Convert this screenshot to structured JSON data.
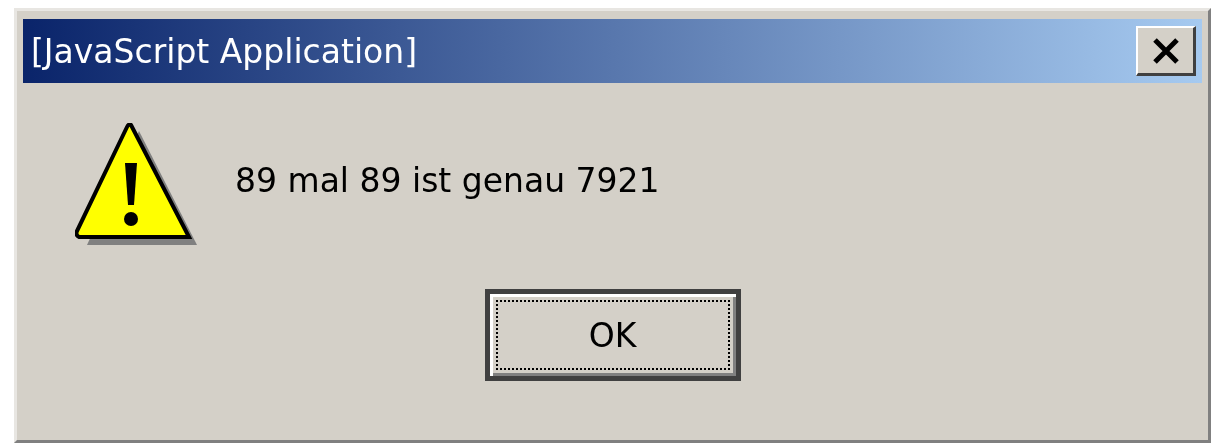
{
  "window": {
    "title": "[JavaScript Application]"
  },
  "message": "89 mal 89 ist genau 7921",
  "buttons": [
    {
      "label": "OK",
      "default": true
    }
  ]
}
